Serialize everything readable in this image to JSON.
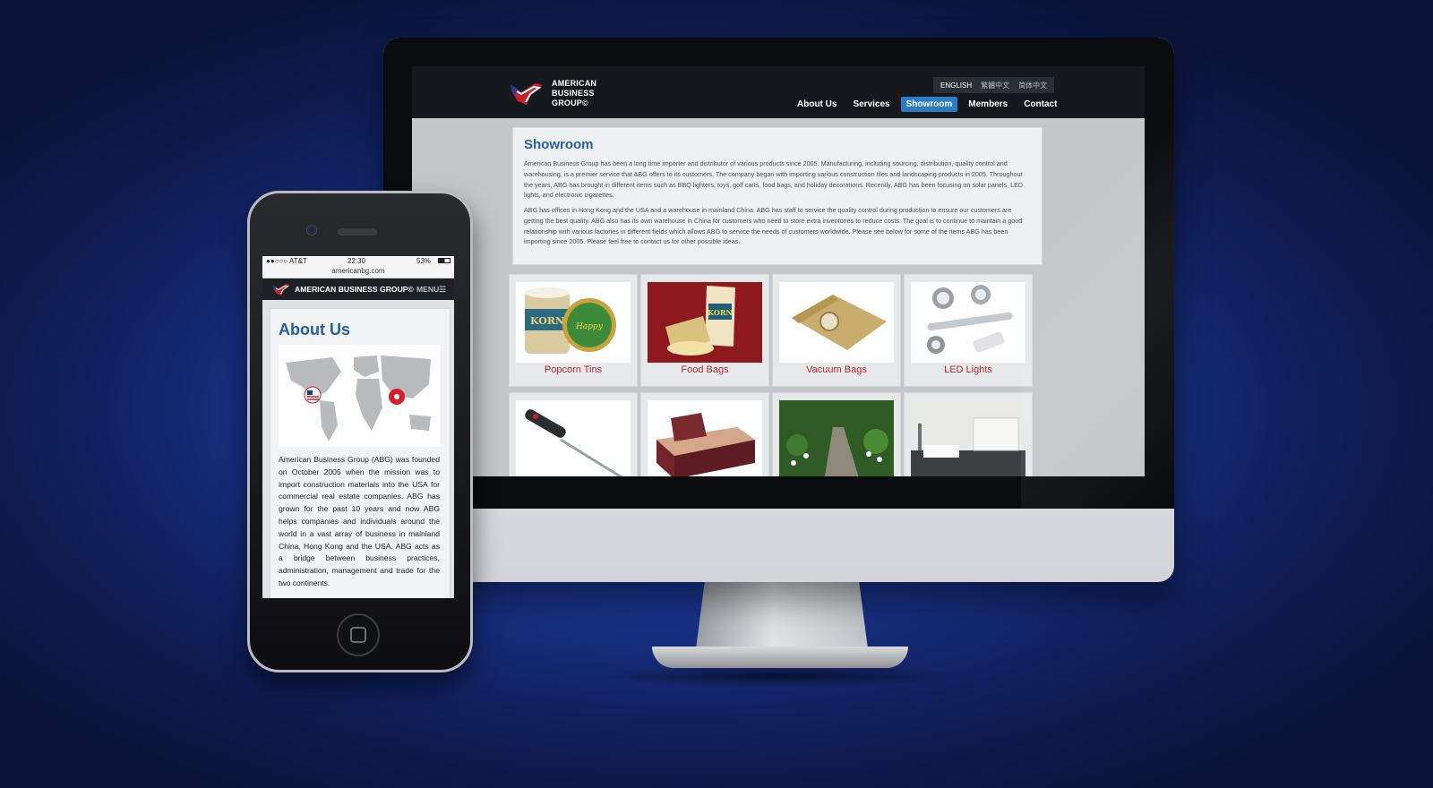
{
  "desktop": {
    "logo_text": "AMERICAN\nBUSINESS\nGROUP©",
    "languages": [
      "ENGLISH",
      "繁體中文",
      "简体中文"
    ],
    "nav": [
      "About Us",
      "Services",
      "Showroom",
      "Members",
      "Contact"
    ],
    "active_nav": "Showroom",
    "page_title": "Showroom",
    "paragraph_1": "American Business Group has been a long time importer and distributor of various products since 2005. Manufacturing, including sourcing, distribution, quality control and warehousing, is a premier service that ABG offers to its customers. The company began with importing various construction tiles and landscaping products in 2005. Throughout the years, ABG has brought in different items such as BBQ lighters, toys, golf carts, food bags, and holiday decorations. Recently, ABG has been focusing on solar panels, LED lights, and electronic cigarettes.",
    "paragraph_2": "ABG has offices in Hong Kong and the USA and a warehouse in mainland China. ABG has staff to service the quality control during production to ensure our customers are getting the best quality. ABG also has its own warehouse in China for customers who need to store extra inventories to reduce costs. The goal is to continue to maintain a good relationship with various factories in different fields which allows ABG to service the needs of customers worldwide. Please see below for some of the items ABG has been importing since 2005. Please feel free to contact us for other possible ideas.",
    "products": [
      {
        "label": "Popcorn Tins",
        "icon": "popcorn-tin"
      },
      {
        "label": "Food Bags",
        "icon": "food-bag"
      },
      {
        "label": "Vacuum Bags",
        "icon": "vacuum-bag"
      },
      {
        "label": "LED Lights",
        "icon": "led-light"
      },
      {
        "label": "",
        "icon": "bbq-lighter"
      },
      {
        "label": "",
        "icon": "casket"
      },
      {
        "label": "",
        "icon": "garden-path"
      },
      {
        "label": "",
        "icon": "modern-interior"
      }
    ],
    "accent_color": "#255fa2",
    "caption_color": "#b5262e",
    "active_nav_color": "#2a7dc3"
  },
  "mobile": {
    "carrier": "●●○○○ AT&T",
    "time": "22:30",
    "battery": "53%",
    "url": "americanbg.com",
    "site_title": "AMERICAN BUSINESS GROUP©",
    "menu_label": "MENU☰",
    "page_title": "About Us",
    "body_text": "American Business Group (ABG) was founded on October 2005 when the mission was to import construction materials into the USA for commercial real estate companies. ABG has grown for the past 10 years and now ABG helps companies and individuals around the world in a vast array of business in mainland China, Hong Kong and the USA. ABG acts as a bridge between business practices, administration, management and trade for the two continents."
  }
}
